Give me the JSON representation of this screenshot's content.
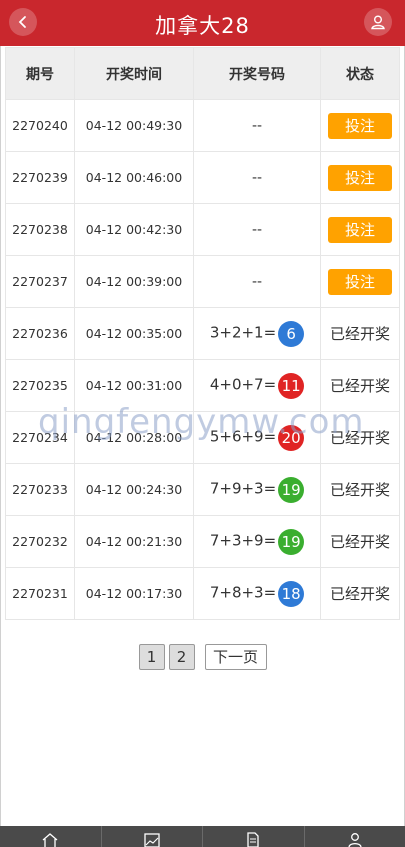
{
  "header": {
    "title": "加拿大28",
    "back_icon": "chevron-left-icon",
    "user_icon": "user-icon",
    "accent": "#c9272d"
  },
  "table": {
    "columns": [
      "期号",
      "开奖时间",
      "开奖号码",
      "状态"
    ],
    "rows": [
      {
        "period": "2270240",
        "time": "04-12 00:49:30",
        "numbers": "--",
        "ball": "",
        "ball_color": "",
        "status": "投注",
        "is_bet": true
      },
      {
        "period": "2270239",
        "time": "04-12 00:46:00",
        "numbers": "--",
        "ball": "",
        "ball_color": "",
        "status": "投注",
        "is_bet": true
      },
      {
        "period": "2270238",
        "time": "04-12 00:42:30",
        "numbers": "--",
        "ball": "",
        "ball_color": "",
        "status": "投注",
        "is_bet": true
      },
      {
        "period": "2270237",
        "time": "04-12 00:39:00",
        "numbers": "--",
        "ball": "",
        "ball_color": "",
        "status": "投注",
        "is_bet": true
      },
      {
        "period": "2270236",
        "time": "04-12 00:35:00",
        "numbers": "3+2+1=",
        "ball": "6",
        "ball_color": "#2e7ad6",
        "status": "已经开奖",
        "is_bet": false
      },
      {
        "period": "2270235",
        "time": "04-12 00:31:00",
        "numbers": "4+0+7=",
        "ball": "11",
        "ball_color": "#e02424",
        "status": "已经开奖",
        "is_bet": false
      },
      {
        "period": "2270234",
        "time": "04-12 00:28:00",
        "numbers": "5+6+9=",
        "ball": "20",
        "ball_color": "#e02424",
        "status": "已经开奖",
        "is_bet": false
      },
      {
        "period": "2270233",
        "time": "04-12 00:24:30",
        "numbers": "7+9+3=",
        "ball": "19",
        "ball_color": "#3aae2f",
        "status": "已经开奖",
        "is_bet": false
      },
      {
        "period": "2270232",
        "time": "04-12 00:21:30",
        "numbers": "7+3+9=",
        "ball": "19",
        "ball_color": "#3aae2f",
        "status": "已经开奖",
        "is_bet": false
      },
      {
        "period": "2270231",
        "time": "04-12 00:17:30",
        "numbers": "7+8+3=",
        "ball": "18",
        "ball_color": "#2e7ad6",
        "status": "已经开奖",
        "is_bet": false
      }
    ]
  },
  "watermark": "qingfengymw.com",
  "pagination": {
    "pages": [
      "1",
      "2"
    ],
    "next_label": "下一页"
  },
  "footer": {
    "icons": [
      "home-icon",
      "image-icon",
      "document-icon",
      "user-icon"
    ]
  },
  "colors": {
    "bet_button": "#ffa200",
    "header_bg": "#eeeeee",
    "footer_bg": "#4a4a4a"
  }
}
